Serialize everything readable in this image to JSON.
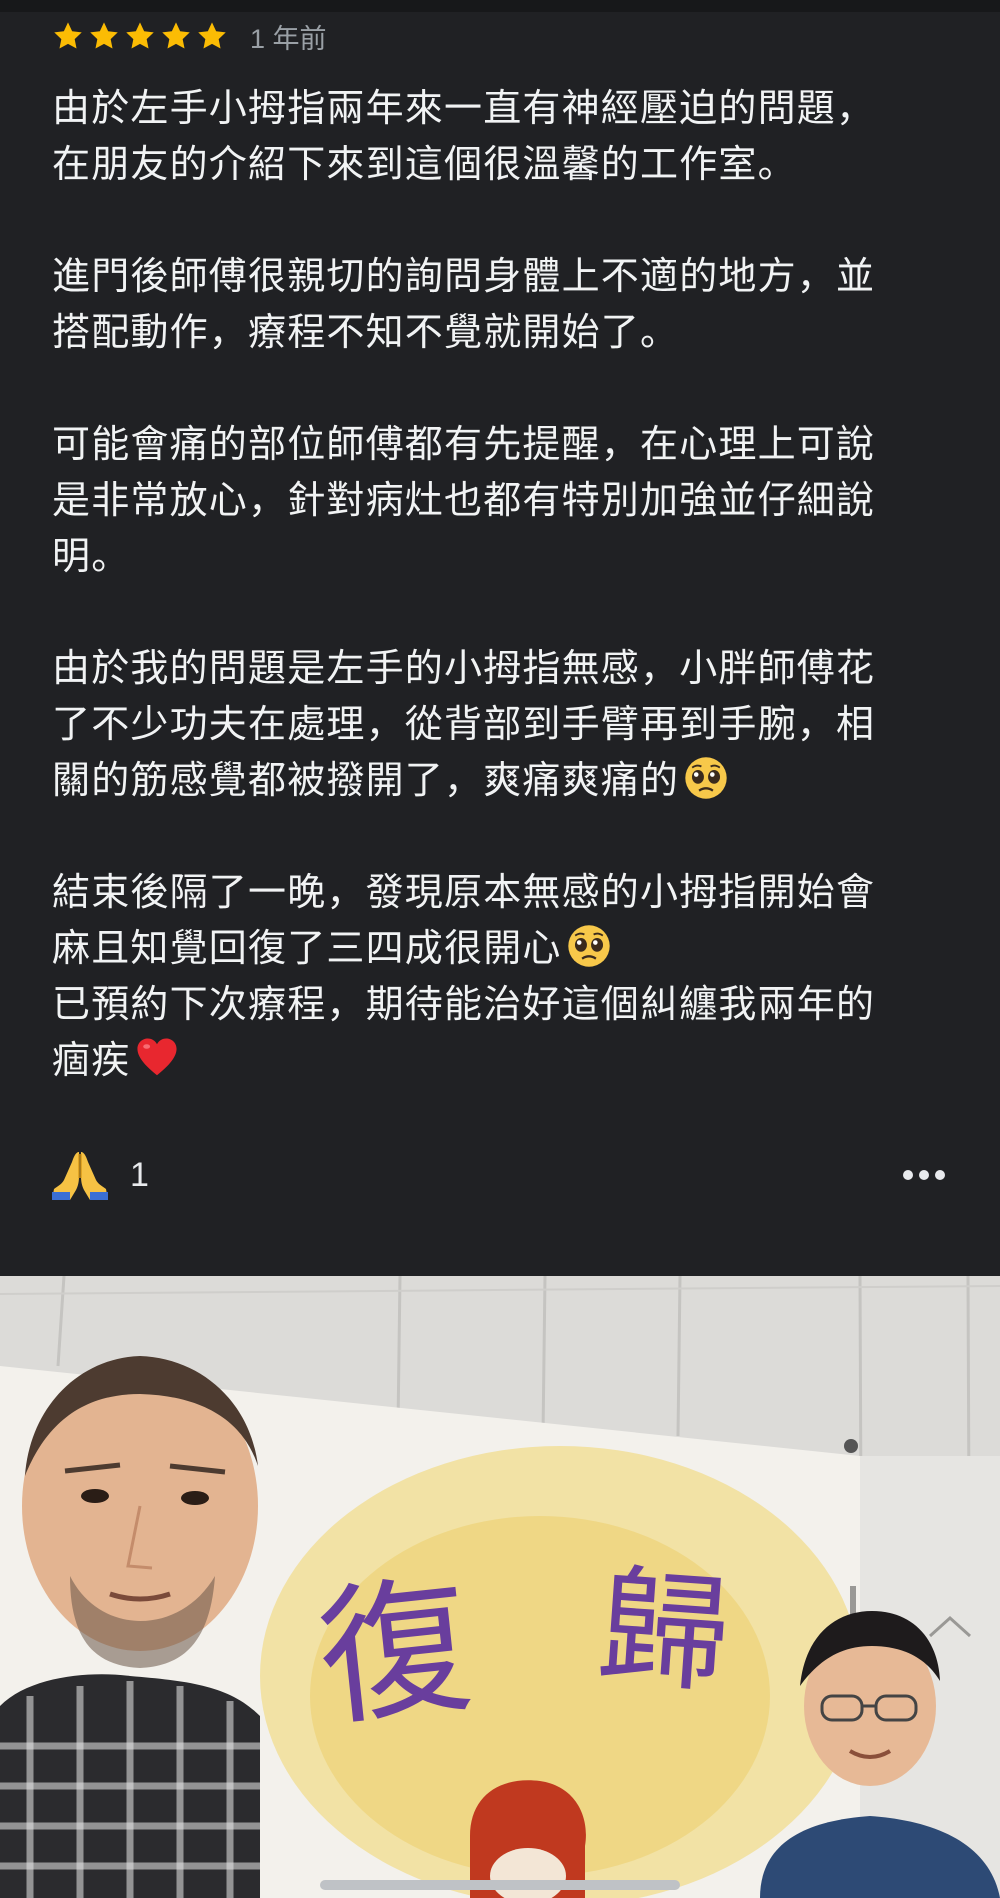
{
  "review": {
    "rating": 5,
    "date": "1 年前",
    "paragraphs": [
      {
        "lines": [
          "由於左手小拇指兩年來一直有神經壓迫的問題，",
          "在朋友的介紹下來到這個很溫馨的工作室。"
        ]
      },
      {
        "lines": [
          "進門後師傅很親切的詢問身體上不適的地方，並",
          "搭配動作，療程不知不覺就開始了。"
        ]
      },
      {
        "lines": [
          "可能會痛的部位師傅都有先提醒，在心理上可說",
          "是非常放心，針對病灶也都有特別加強並仔細說",
          "明。"
        ]
      },
      {
        "lines": [
          "由於我的問題是左手的小拇指無感，小胖師傅花",
          "了不少功夫在處理，從背部到手臂再到手腕，相",
          "關的筋感覺都被撥開了，爽痛爽痛的"
        ]
      },
      {
        "lines": [
          "結束後隔了一晚，發現原本無感的小拇指開始會",
          "麻且知覺回復了三四成很開心",
          "已預約下次療程，期待能治好這個糾纏我兩年的",
          "痼疾"
        ]
      }
    ]
  },
  "reactions": {
    "icon": "folded-hands-icon",
    "count": "1"
  },
  "more": {
    "icon": "more-horizontal-icon"
  },
  "photo": {
    "banner_text_1": "復",
    "banner_text_2": "歸"
  },
  "colors": {
    "background": "#202124",
    "star": "#fbbc04",
    "text": "#f1f3f4",
    "muted": "#9aa0a6"
  }
}
